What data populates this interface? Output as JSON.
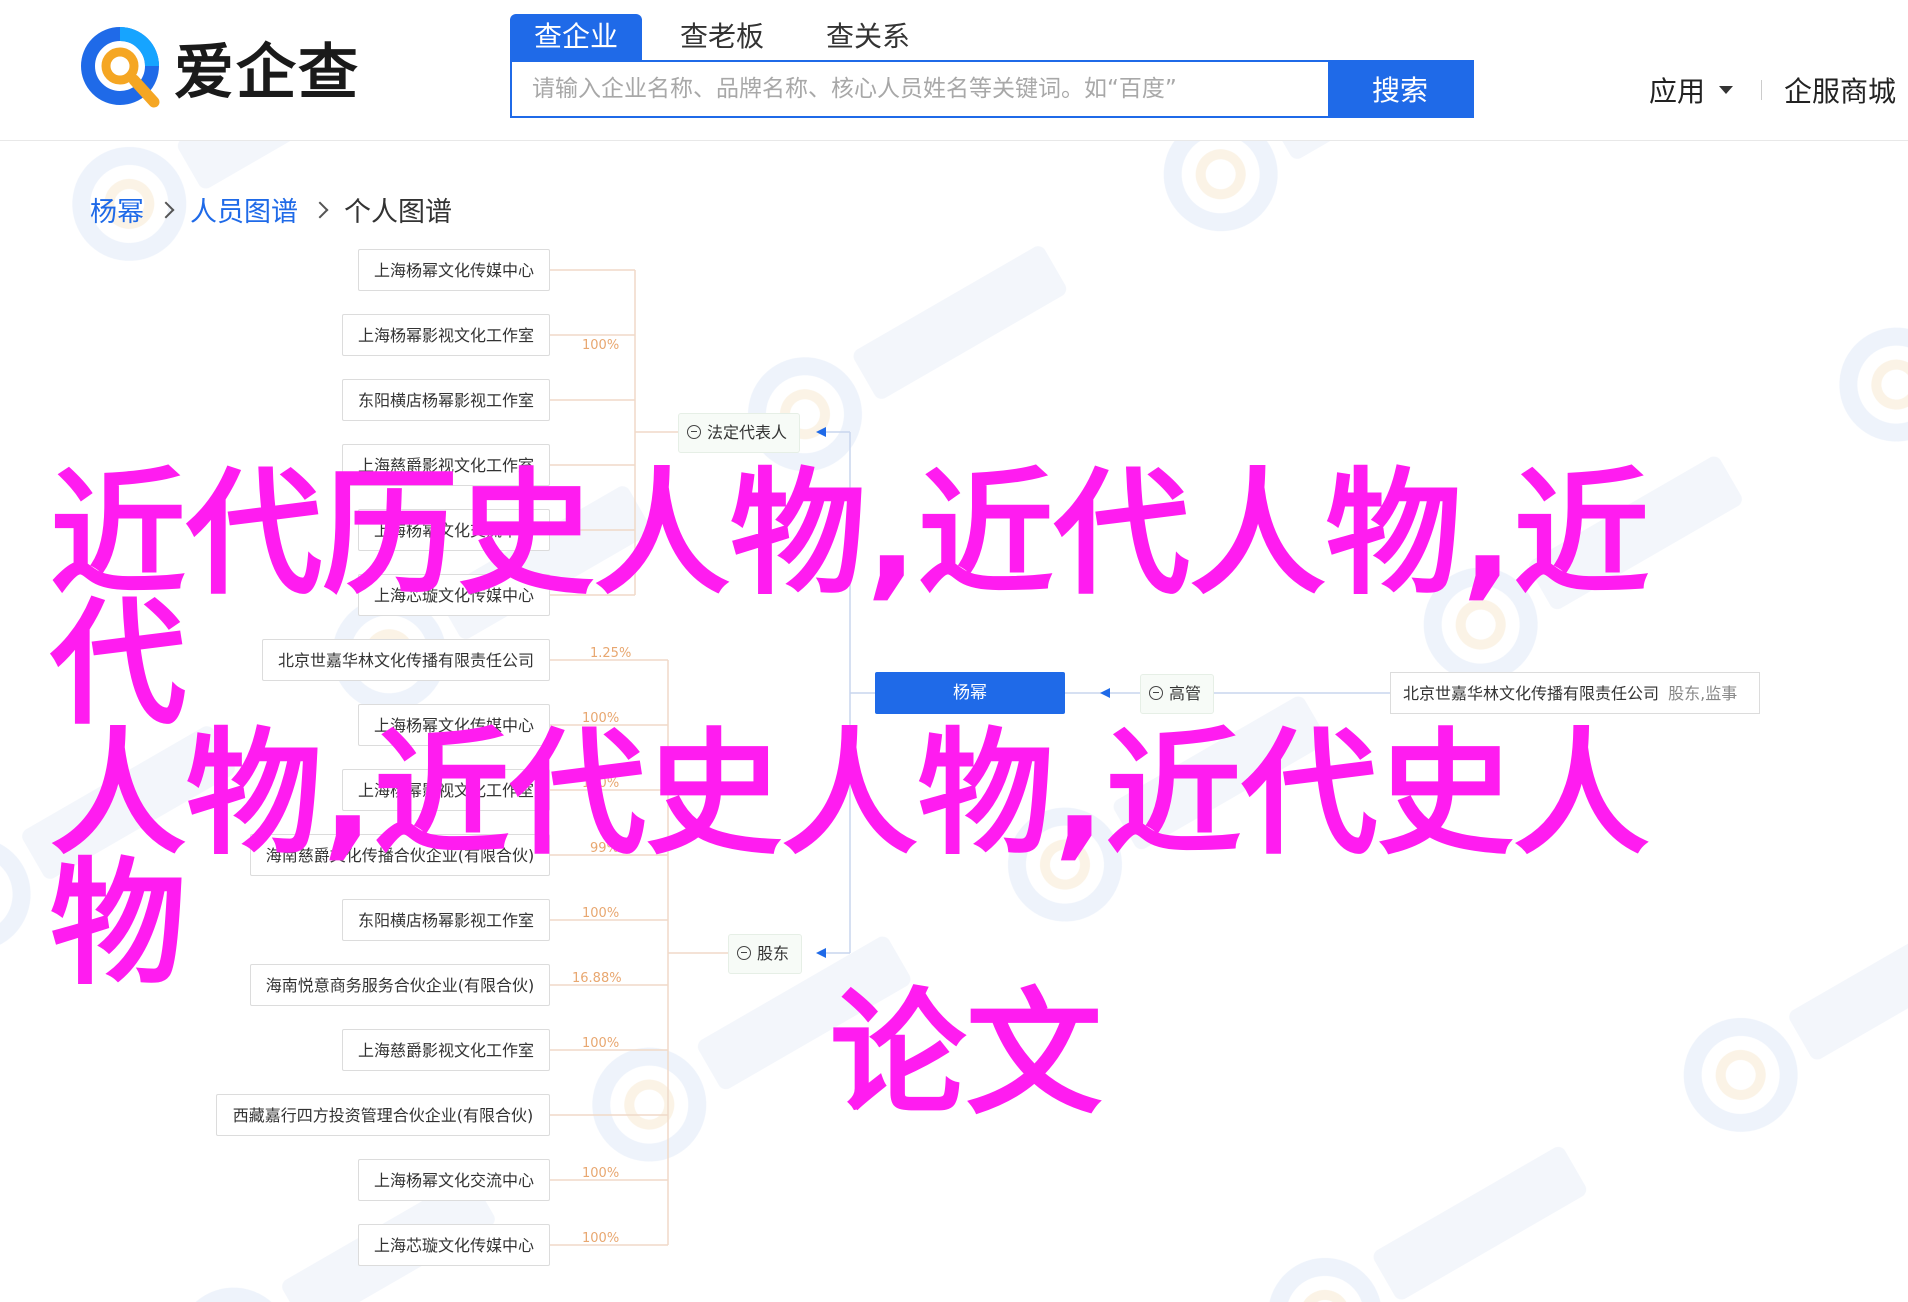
{
  "header": {
    "logo_text": "爱企查",
    "search_tabs": [
      {
        "label": "查企业",
        "active": true
      },
      {
        "label": "查老板",
        "active": false
      },
      {
        "label": "查关系",
        "active": false
      }
    ],
    "search_placeholder": "请输入企业名称、品牌名称、核心人员姓名等关键词。如“百度”",
    "search_button": "搜索",
    "nav": {
      "apps": "应用",
      "services": "企服商城"
    }
  },
  "breadcrumb": {
    "person": "杨幂",
    "graph": "人员图谱",
    "current": "个人图谱"
  },
  "graph": {
    "legal_rep_label": "法定代表人",
    "shareholder_label": "股东",
    "center_label": "杨幂",
    "manager_label": "高管",
    "legal_rep_companies": [
      "上海杨幂文化传媒中心",
      "上海杨幂影视文化工作室",
      "东阳横店杨幂影视工作室",
      "上海慈爵影视文化工作室",
      "上海杨幂文化交流中心",
      "上海芯璇文化传媒中心"
    ],
    "shareholder_companies": [
      {
        "name": "北京世嘉华林文化传播有限责任公司",
        "pct": "1.25%"
      },
      {
        "name": "上海杨幂文化传媒中心",
        "pct": "100%"
      },
      {
        "name": "上海杨幂影视文化工作室",
        "pct": "100%"
      },
      {
        "name": "海南慈爵文化传播合伙企业(有限合伙)",
        "pct": "99%"
      },
      {
        "name": "东阳横店杨幂影视工作室",
        "pct": "100%"
      },
      {
        "name": "海南悦意商务服务合伙企业(有限合伙)",
        "pct": "16.88%"
      },
      {
        "name": "上海慈爵影视文化工作室",
        "pct": "100%"
      },
      {
        "name": "西藏嘉行四方投资管理合伙企业(有限合伙)",
        "pct": ""
      },
      {
        "name": "上海杨幂文化交流中心",
        "pct": "100%"
      },
      {
        "name": "上海芯璇文化传媒中心",
        "pct": "100%"
      }
    ],
    "manager_company": "北京世嘉华林文化传播有限责任公司",
    "manager_role": "股东,监事",
    "legal_pct": "100%"
  },
  "overlay": {
    "line1": "近代历史人物,近代人物,近代",
    "line2": "人物,近代史人物,近代史人物",
    "line3": "论文"
  },
  "colors": {
    "brand": "#1f6ae8",
    "overlay": "#ff1cf0",
    "pct": "#e8a770"
  }
}
